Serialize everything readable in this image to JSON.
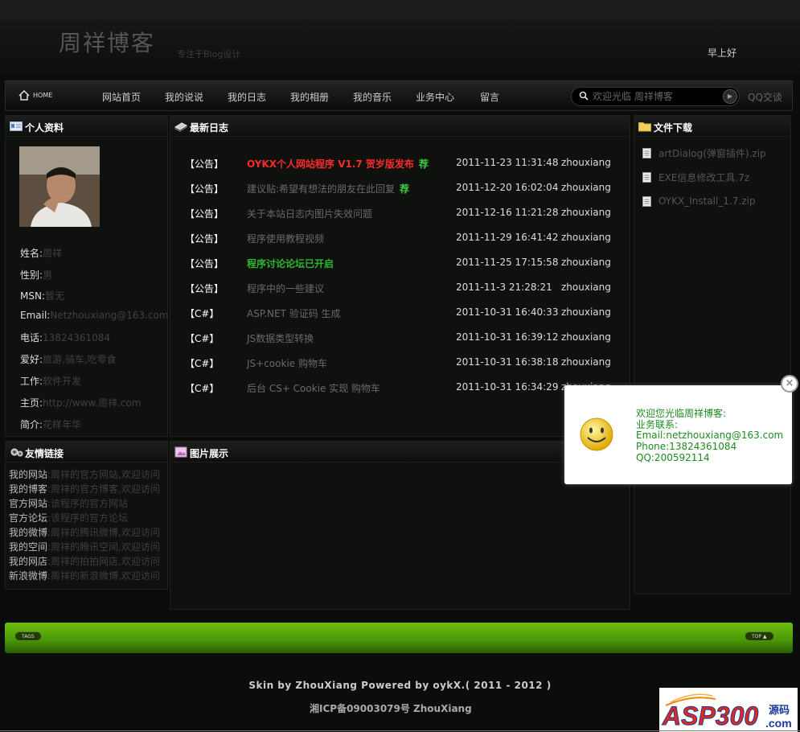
{
  "header": {
    "title": "周祥博客",
    "subtitle": "专注于Blog设计",
    "greeting": "早上好"
  },
  "nav": {
    "home_label": "HOME",
    "items": [
      "网站首页",
      "我的说说",
      "我的日志",
      "我的相册",
      "我的音乐",
      "业务中心",
      "留言"
    ],
    "search_placeholder": "欢迎光临 周祥博客",
    "qq_label": "QQ交谈"
  },
  "profile": {
    "title": "个人资料",
    "rows": [
      {
        "key": "姓名:",
        "value": "周祥"
      },
      {
        "key": "性别:",
        "value": "男"
      },
      {
        "key": "MSN:",
        "value": "暂无"
      },
      {
        "key": "Email:",
        "value": "Netzhouxiang@163.com"
      },
      {
        "key": "电话:",
        "value": "13824361084"
      },
      {
        "key": "爱好:",
        "value": "旅游,骑车,吃零食"
      },
      {
        "key": "工作:",
        "value": "软件开发"
      },
      {
        "key": "主页:",
        "value": "http://www.周祥.com"
      },
      {
        "key": "简介:",
        "value": "花样年华"
      }
    ]
  },
  "articles": {
    "title": "最新日志",
    "rows": [
      {
        "category": "【公告】",
        "title": "OYKX个人网站程序 V1.7 贺岁版发布",
        "rec": "荐",
        "date": "2011-11-23 11:31:48",
        "author": "zhouxiang",
        "color": "#ff2a2a",
        "bold": true
      },
      {
        "category": "【公告】",
        "title": "建议贴:希望有想法的朋友在此回复",
        "rec": "荐",
        "date": "2011-12-20 16:02:04",
        "author": "zhouxiang",
        "color": "#6a6a6a",
        "bold": false
      },
      {
        "category": "【公告】",
        "title": "关于本站日志内图片失效问题",
        "rec": "",
        "date": "2011-12-16 11:21:28",
        "author": "zhouxiang",
        "color": "#6a6a6a",
        "bold": false
      },
      {
        "category": "【公告】",
        "title": "程序使用教程视频",
        "rec": "",
        "date": "2011-11-29 16:41:42",
        "author": "zhouxiang",
        "color": "#6a6a6a",
        "bold": false
      },
      {
        "category": "【公告】",
        "title": "程序讨论论坛已开启",
        "rec": "",
        "date": "2011-11-25 17:15:58",
        "author": "zhouxiang",
        "color": "#2fb52f",
        "bold": true
      },
      {
        "category": "【公告】",
        "title": "程序中的一些建议",
        "rec": "",
        "date": "2011-11-3 21:28:21",
        "author": "zhouxiang",
        "color": "#6a6a6a",
        "bold": false
      },
      {
        "category": "【C#】",
        "title": "ASP.NET 验证码 生成",
        "rec": "",
        "date": "2011-10-31 16:40:33",
        "author": "zhouxiang",
        "color": "#6a6a6a",
        "bold": false
      },
      {
        "category": "【C#】",
        "title": "JS数据类型转换",
        "rec": "",
        "date": "2011-10-31 16:39:12",
        "author": "zhouxiang",
        "color": "#6a6a6a",
        "bold": false
      },
      {
        "category": "【C#】",
        "title": "JS+cookie 购物车",
        "rec": "",
        "date": "2011-10-31 16:38:18",
        "author": "zhouxiang",
        "color": "#6a6a6a",
        "bold": false
      },
      {
        "category": "【C#】",
        "title": "后台 CS+ Cookie 实现 购物车",
        "rec": "",
        "date": "2011-10-31 16:34:29",
        "author": "zhouxiang",
        "color": "#6a6a6a",
        "bold": false
      }
    ]
  },
  "files": {
    "title": "文件下载",
    "items": [
      "artDialog(弹窗插件).zip",
      "EXE信息修改工具.7z",
      "OYKX_Install_1.7.zip"
    ]
  },
  "links": {
    "title": "友情链接",
    "items": [
      {
        "name": "我的网站",
        "desc": ":周祥的官方网站,欢迎访问"
      },
      {
        "name": "我的博客",
        "desc": ":周祥的官方博客,欢迎访问"
      },
      {
        "name": "官方网站",
        "desc": ":该程序的官方网站"
      },
      {
        "name": "官方论坛",
        "desc": ":该程序的官方论坛"
      },
      {
        "name": "我的微博",
        "desc": ":周祥的腾讯微博,欢迎访问"
      },
      {
        "name": "我的空间",
        "desc": ":周祥的腾讯空间,欢迎访问"
      },
      {
        "name": "我的网店",
        "desc": ":周祥的拍拍网店,欢迎访问"
      },
      {
        "name": "新浪微博",
        "desc": ":周祥的新浪微博,欢迎访问"
      }
    ]
  },
  "gallery": {
    "title": "图片展示"
  },
  "footer": {
    "tags_label": "TAGS",
    "top_label": "TOP ▲",
    "powered": "Skin by ZhouXiang Powered by oykX.( 2011 - 2012 )",
    "icp": "湘ICP备09003079号  ZhouXiang"
  },
  "popup": {
    "lines": [
      "欢迎您光临周祥博客:",
      "业务联系:",
      "Email:netzhouxiang@163.com",
      "Phone:13824361084",
      "QQ:200592114"
    ],
    "close": "×"
  },
  "watermark": {
    "text": "ASP300",
    "suffix": "源码",
    "domain": ".com"
  }
}
